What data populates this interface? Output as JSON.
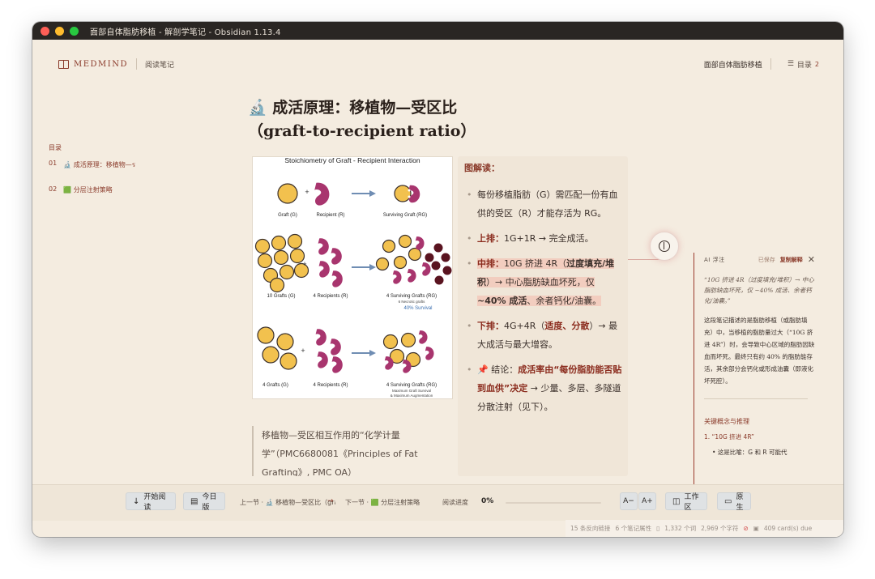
{
  "window": {
    "title": "面部自体脂肪移植 - 解剖学笔记 - Obsidian 1.13.4"
  },
  "topbar": {
    "logo": "MEDMIND",
    "mode": "阅读笔记",
    "doc_name": "面部自体脂肪移植",
    "toc_label": "目录",
    "toc_count": "2"
  },
  "toc": {
    "title": "目录",
    "items": [
      {
        "num": "01",
        "label": "🔬 成活原理：移植物—ร"
      },
      {
        "num": "02",
        "label": "🟩 分层注射策略"
      }
    ]
  },
  "heading": {
    "text": "🔬 成活原理：移植物—受区比（graft-to-recipient ratio）"
  },
  "figure": {
    "title": "Stoichiometry of Graft - Recipient Interaction",
    "labels": {
      "graft": "Graft (G)",
      "recipient": "Recipient (R)",
      "surviving": "Surviving Graft (RG)",
      "grafts10": "10 Grafts (G)",
      "recip4": "4 Recipients (R)",
      "surv4": "4 Surviving Grafts (RG)",
      "necrotic": "6 Necrotic grafts",
      "survival40": "40% Survival",
      "grafts4": "4 Grafts (G)",
      "recip4b": "4 Recipients (R)",
      "surv4b": "4 Surviving Grafts (RG)",
      "max1": "Maximum Graft Survival",
      "max2": "& Maximum Augmentation"
    },
    "colors": {
      "graft": "#f2c14e",
      "recipient": "#a8356e",
      "necrotic": "#5a1420",
      "arrow": "#6f8db3"
    }
  },
  "panel": {
    "title": "图解读：",
    "items": [
      {
        "plain": "每份移植脂肪（G）需匹配一份有血供的受区（R）才能存活为 RG。"
      },
      {
        "label": "上排：",
        "text": "1G+1R → 完全成活。"
      },
      {
        "label": "中排：",
        "p1": "10G 挤进 4R（",
        "p2": "过度填充/堆积",
        "p3": "）→ 中心脂肪缺血坏死，仅 ",
        "p4": "~40% 成活",
        "p5": "、余者钙化/油囊。"
      },
      {
        "label": "下排：",
        "p1": "4G+4R（",
        "p2": "适度、分散",
        "p3": "）→ 最大成活与最大增容。"
      },
      {
        "label": "📌 结论：",
        "p2": "成活率由“每份脂肪能否贴到血供”决定",
        "p3": " → 少量、多层、多隧道分散注射（见下）。"
      }
    ]
  },
  "quote": {
    "text": "移植物—受区相互作用的“化学计量学”（PMC6680081《Principles of Fat Grafting》, PMC OA）"
  },
  "annotation": {
    "label": "AI 浮注",
    "saved": "已保存",
    "copy": "复制解释",
    "close": "✕",
    "quote": "“10G 挤进 4R（过度填充/堆积）→ 中心脂肪缺血坏死，仅 ~40% 成活、余者钙化/油囊。”",
    "body": "这段笔记描述的是脂肪移植（或脂肪填充）中，当移植的脂肪量过大（“10G 挤进 4R”）时，会导致中心区域的脂肪因缺血而坏死。最终只有约 40% 的脂肪能存活，其余部分会钙化或形成油囊（即液化坏死腔）。",
    "section": "关键概念与推理",
    "li1": "1. “10G 挤进 4R”",
    "li2": "这是比喻：G 和 R 可能代"
  },
  "bottombar": {
    "start": "开始阅读",
    "today": "今日版",
    "prev": "上一节 · 🔬 移植物—受区比（graft-",
    "next": "下一节 · 🟩 分层注射策略",
    "progress_label": "阅读进度",
    "progress_value": "0%",
    "progress_fraction": 0,
    "font_minus": "A−",
    "font_plus": "A+",
    "workspace": "工作区",
    "original": "原生"
  },
  "status": {
    "backlinks": "15 条反向链接",
    "props": "6 个笔记属性",
    "words": "1,332 个词",
    "chars": "2,969 个字符",
    "cards": "409 card(s) due"
  }
}
